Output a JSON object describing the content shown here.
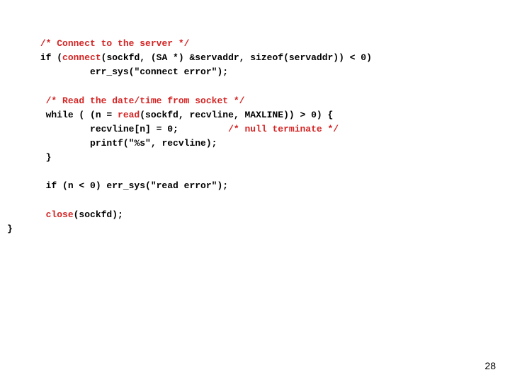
{
  "code": {
    "l1_pad": "      ",
    "l1_c1": "/* Connect to the server */",
    "l2_pad": "      ",
    "l2_t1": "if (",
    "l2_r1": "connect",
    "l2_t2": "(sockfd, (SA *) &servaddr, sizeof(servaddr)) < 0)",
    "l3_pad": "               ",
    "l3_t1": "err_sys(\"connect error\");",
    "blank1": "",
    "l4_pad": "       ",
    "l4_c1": "/* Read the date/time from socket */",
    "l5_pad": "       ",
    "l5_t1": "while ( (n = ",
    "l5_r1": "read",
    "l5_t2": "(sockfd, recvline, MAXLINE)) > 0) {",
    "l6_pad": "               ",
    "l6_t1": "recvline[n] = 0;         ",
    "l6_c1": "/* null terminate */",
    "l7_pad": "               ",
    "l7_t1": "printf(\"%s\", recvline);",
    "l8_pad": "       ",
    "l8_t1": "}",
    "blank2": "",
    "l9_pad": "       ",
    "l9_t1": "if (n < 0) err_sys(\"read error\");",
    "blank3": "",
    "l10_pad": "       ",
    "l10_r1": "close",
    "l10_t1": "(sockfd);",
    "l11_t1": "}"
  },
  "page_number": "28"
}
